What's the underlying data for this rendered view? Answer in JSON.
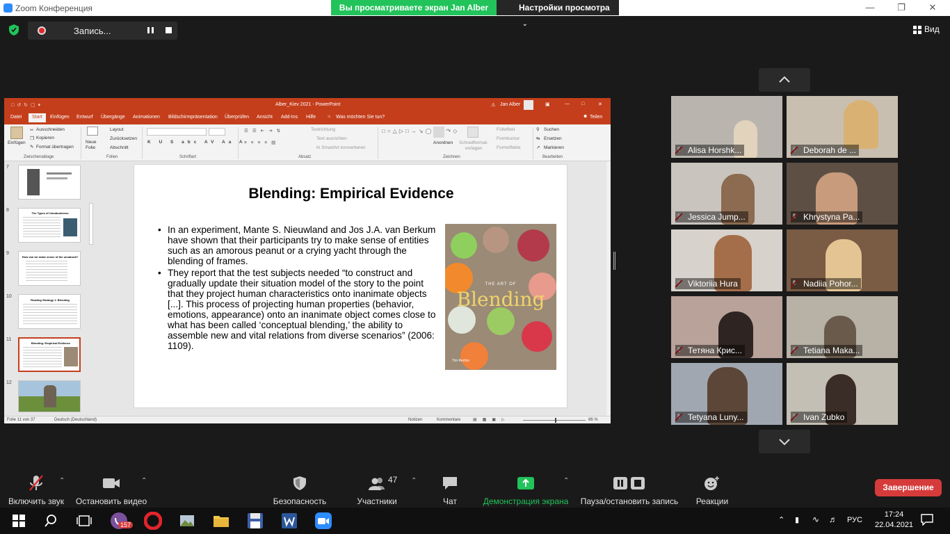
{
  "window": {
    "title": "Zoom Конференция",
    "share_banner": "Вы просматриваете экран Jan Alber",
    "view_options": "Настройки просмотра",
    "view_button": "Вид"
  },
  "recording": {
    "label": "Запись..."
  },
  "ppt": {
    "title": "Alber_Kiev 2021  -  PowerPoint",
    "user": "Jan Alber",
    "tabs": [
      "Datei",
      "Start",
      "Einfügen",
      "Entwurf",
      "Übergänge",
      "Animationen",
      "Bildschirmpräsentation",
      "Überprüfen",
      "Ansicht",
      "Add-Ins",
      "Hilfe"
    ],
    "tell_me": "Was möchten Sie tun?",
    "share": "Teilen",
    "ribbon": {
      "paste": "Einfügen",
      "cut": "Ausschneiden",
      "copy": "Kopieren",
      "format_painter": "Format übertragen",
      "clipboard": "Zwischenablage",
      "new_slide": "Neue Folie",
      "layout": "Layout",
      "reset": "Zurücksetzen",
      "section": "Abschnitt",
      "slides": "Folien",
      "font": "Schriftart",
      "paragraph": "Absatz",
      "text_direction": "Textrichtung",
      "align_text": "Text ausrichten",
      "smartart": "In SmartArt konvertieren",
      "arrange": "Anordnen",
      "quick_styles": "Schnellformat-vorlagen",
      "fill": "Fülleffekt",
      "outline": "Formkontur",
      "effects": "Formeffekte",
      "drawing": "Zeichnen",
      "find": "Suchen",
      "replace": "Ersetzen",
      "select": "Markieren",
      "editing": "Bearbeiten"
    },
    "thumb_numbers": [
      "7",
      "8",
      "9",
      "10",
      "11",
      "12"
    ],
    "thumb_titles": [
      "",
      "The Types of Unnaturalness",
      "How can we make sense of the unnatural?",
      "Reading Strategy 1: Blending",
      "Blending: Empirical Evidence",
      ""
    ],
    "slide": {
      "title": "Blending: Empirical Evidence",
      "bullets": [
        "In an experiment, Mante S. Nieuwland and Jos J.A. van Berkum have shown that their participants try to make sense of entities such as an amorous peanut or a crying yacht through the blending of frames.",
        "They report that the test subjects needed “to construct and gradually update their situation model of the story to the point that they project human characteristics onto inanimate objects [...]. This process of projecting human properties (behavior, emotions, appearance) onto an inanimate object comes close to what has been called ‘conceptual blending,’ the ability to assemble new and vital relations from diverse scenarios” (2006: 1109)."
      ],
      "book_art": "THE ART OF",
      "book_title": "Blending",
      "book_author": "Tim Rechis"
    },
    "status": {
      "slide_counter": "Folie 11 von 37",
      "language": "Deutsch (Deutschland)",
      "notes": "Notizen",
      "comments": "Kommentare",
      "zoom": "86 %"
    }
  },
  "participants": [
    {
      "name": "Alisa Horshk...",
      "bg": "#b9b5ae"
    },
    {
      "name": "Deborah de ...",
      "bg": "#c8bfb0"
    },
    {
      "name": "Jessica Jump...",
      "bg": "#c9c4be"
    },
    {
      "name": "Khrystyna Pa...",
      "bg": "#5e4f44"
    },
    {
      "name": "Viktoriia Hura",
      "bg": "#d7d2cb"
    },
    {
      "name": "Nadiia Pohor...",
      "bg": "#7a5b44"
    },
    {
      "name": "Тетяна Крис...",
      "bg": "#b9a29a"
    },
    {
      "name": "Tetiana Maka...",
      "bg": "#b8b1a6"
    },
    {
      "name": "Tetyana Luny...",
      "bg": "#a0a7b0"
    },
    {
      "name": "Ivan Zubko",
      "bg": "#c4bfb4"
    }
  ],
  "toolbar": {
    "mute": "Включить звук",
    "video": "Остановить видео",
    "security": "Безопасность",
    "participants": "Участники",
    "participant_count": "47",
    "chat": "Чат",
    "share": "Демонстрация экрана",
    "record": "Пауза/остановить запись",
    "reactions": "Реакции",
    "end": "Завершение"
  },
  "taskbar": {
    "viber_badge": "157",
    "language": "РУС",
    "time": "17:24",
    "date": "22.04.2021"
  },
  "colors": {
    "zoom_green": "#21c35a",
    "ppt_accent": "#c43e1c",
    "end_red": "#d63b3b",
    "mute_red": "#e02828"
  }
}
